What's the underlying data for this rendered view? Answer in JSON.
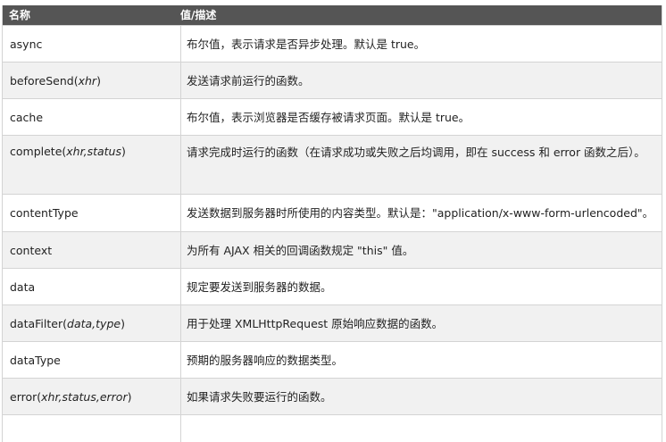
{
  "header": {
    "name": "名称",
    "desc": "值/描述"
  },
  "rows": [
    {
      "name": "async",
      "args": "",
      "desc": "布尔值，表示请求是否异步处理。默认是 true。"
    },
    {
      "name": "beforeSend",
      "args": "xhr",
      "desc": "发送请求前运行的函数。"
    },
    {
      "name": "cache",
      "args": "",
      "desc": "布尔值，表示浏览器是否缓存被请求页面。默认是 true。"
    },
    {
      "name": "complete",
      "args": "xhr,status",
      "desc": "请求完成时运行的函数（在请求成功或失败之后均调用，即在 success 和 error 函数之后）。"
    },
    {
      "name": "contentType",
      "args": "",
      "desc": "发送数据到服务器时所使用的内容类型。默认是：\"application/x-www-form-urlencoded\"。"
    },
    {
      "name": "context",
      "args": "",
      "desc": "为所有 AJAX 相关的回调函数规定 \"this\" 值。"
    },
    {
      "name": "data",
      "args": "",
      "desc": "规定要发送到服务器的数据。"
    },
    {
      "name": "dataFilter",
      "args": "data,type",
      "desc": "用于处理 XMLHttpRequest 原始响应数据的函数。"
    },
    {
      "name": "dataType",
      "args": "",
      "desc": "预期的服务器响应的数据类型。"
    },
    {
      "name": "error",
      "args": "xhr,status,error",
      "desc": "如果请求失败要运行的函数。"
    }
  ]
}
